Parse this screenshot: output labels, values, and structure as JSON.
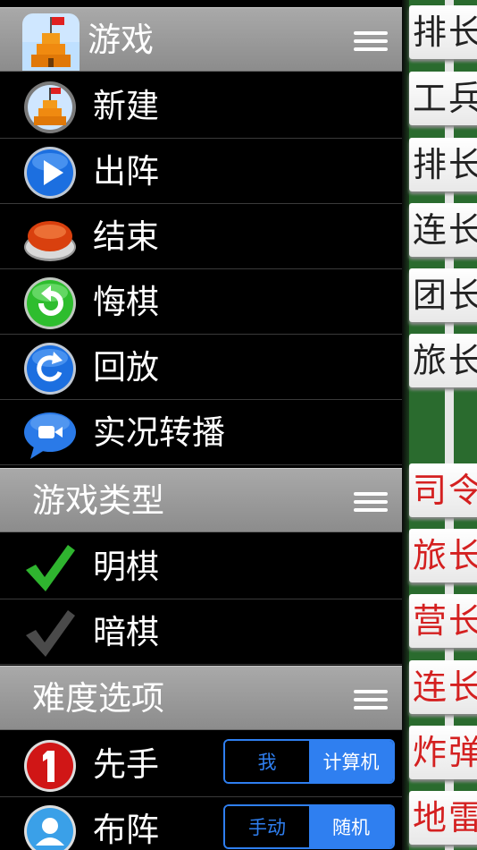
{
  "menu": {
    "game_header": {
      "title": "游戏"
    },
    "game_items": [
      {
        "label": "新建",
        "icon": "castle-icon"
      },
      {
        "label": "出阵",
        "icon": "play-icon"
      },
      {
        "label": "结束",
        "icon": "stop-button-icon"
      },
      {
        "label": "悔棋",
        "icon": "undo-icon"
      },
      {
        "label": "回放",
        "icon": "replay-icon"
      },
      {
        "label": "实况转播",
        "icon": "live-video-icon"
      }
    ],
    "type_header": {
      "title": "游戏类型"
    },
    "type_items": [
      {
        "label": "明棋",
        "icon": "checkmark-green-icon",
        "selected": true
      },
      {
        "label": "暗棋",
        "icon": "checkmark-gray-icon",
        "selected": false
      }
    ],
    "difficulty_header": {
      "title": "难度选项"
    },
    "difficulty_items": [
      {
        "label": "先手",
        "icon": "number-one-icon",
        "options": [
          "我",
          "计算机"
        ],
        "selected": "计算机"
      },
      {
        "label": "布阵",
        "icon": "user-icon",
        "options": [
          "手动",
          "随机"
        ],
        "selected": "随机"
      }
    ]
  },
  "board": {
    "black_pieces": [
      "排长",
      "工兵",
      "排长",
      "连长",
      "团长",
      "旅长"
    ],
    "red_pieces": [
      "司令",
      "旅长",
      "营长",
      "连长",
      "炸弹",
      "地雷"
    ]
  },
  "colors": {
    "accent_blue": "#2f7ff0",
    "board_green": "#2a6b2e",
    "red_piece": "#d42020",
    "header_gray": "#9a9a9a"
  }
}
